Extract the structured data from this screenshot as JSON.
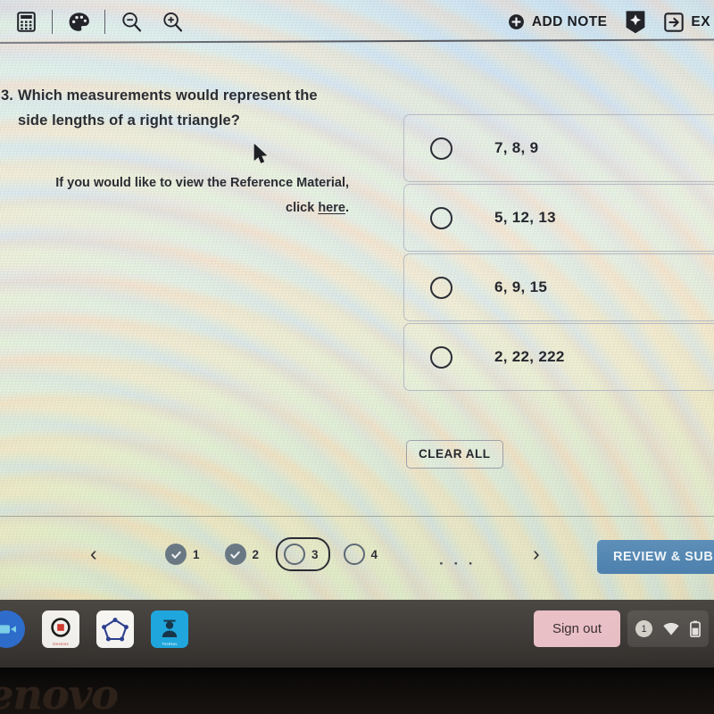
{
  "toolbar": {
    "left_tools": [
      {
        "name": "calculator-icon",
        "label": "Calculator"
      },
      {
        "name": "palette-icon",
        "label": "Color Palette"
      },
      {
        "name": "zoom-out-icon",
        "label": "Zoom Out"
      },
      {
        "name": "zoom-in-icon",
        "label": "Zoom In"
      }
    ],
    "add_note_label": "ADD NOTE",
    "bookmark_icon_name": "bookmark-flag-icon",
    "exit_label": "EX"
  },
  "question": {
    "number": "3.",
    "stem": "Which measurements would represent the side lengths of a right triangle?",
    "reference_note": "If you would like to view the Reference Material,",
    "reference_click_prefix": "click ",
    "reference_link_text": "here",
    "reference_suffix": ".",
    "options": [
      {
        "id": "a",
        "text": "7, 8, 9",
        "selected": false
      },
      {
        "id": "b",
        "text": "5, 12, 13",
        "selected": false
      },
      {
        "id": "c",
        "text": "6, 9, 15",
        "selected": false
      },
      {
        "id": "d",
        "text": "2, 22, 222",
        "selected": false
      }
    ],
    "clear_all_label": "CLEAR ALL"
  },
  "navigation": {
    "prev_label": "‹",
    "next_label": "›",
    "ellipsis": "· · ·",
    "pages": [
      {
        "number": "1",
        "state": "answered"
      },
      {
        "number": "2",
        "state": "answered"
      },
      {
        "number": "3",
        "state": "current"
      },
      {
        "number": "4",
        "state": "unanswered"
      }
    ],
    "review_submit_label": "REVIEW & SUBMIT"
  },
  "shelf": {
    "apps": [
      {
        "name": "shelf-app-blue-circle",
        "caption": ""
      },
      {
        "name": "shelf-app-desmos",
        "caption": "Desmos"
      },
      {
        "name": "shelf-app-geogebra",
        "caption": ""
      },
      {
        "name": "shelf-app-testnav",
        "caption": "TestNav"
      }
    ],
    "sign_out_label": "Sign out",
    "tray": {
      "avatar_label": "1",
      "wifi_icon_name": "wifi-icon",
      "battery_icon_name": "battery-icon"
    }
  },
  "device": {
    "brand_text": "enovo"
  },
  "colors": {
    "accent_blue": "#4d80ad",
    "pager_done": "#6a7884",
    "sign_out_bg": "#e9c0c6",
    "text_dark": "#2b2d33"
  }
}
